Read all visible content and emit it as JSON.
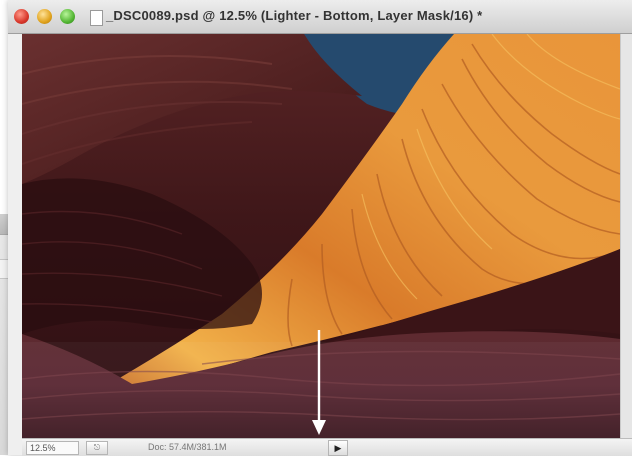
{
  "window": {
    "title": "_DSC0089.psd @ 12.5% (Lighter - Bottom, Layer Mask/16) *"
  },
  "icons": {
    "close": "close-button",
    "minimize": "minimize-button",
    "zoom": "zoom-button",
    "document": "document-icon",
    "arrow": "down-arrow-icon",
    "play": "play-triangle-icon"
  },
  "statusbar": {
    "zoom": "12.5%",
    "doc_info": "Doc: 57.4M/381.1M",
    "play_glyph": "▶"
  },
  "colors": {
    "sky": "#254a6e",
    "rock_dark": "#4a1d22",
    "rock_orange": "#e0892e",
    "arrow": "#ffffff"
  }
}
